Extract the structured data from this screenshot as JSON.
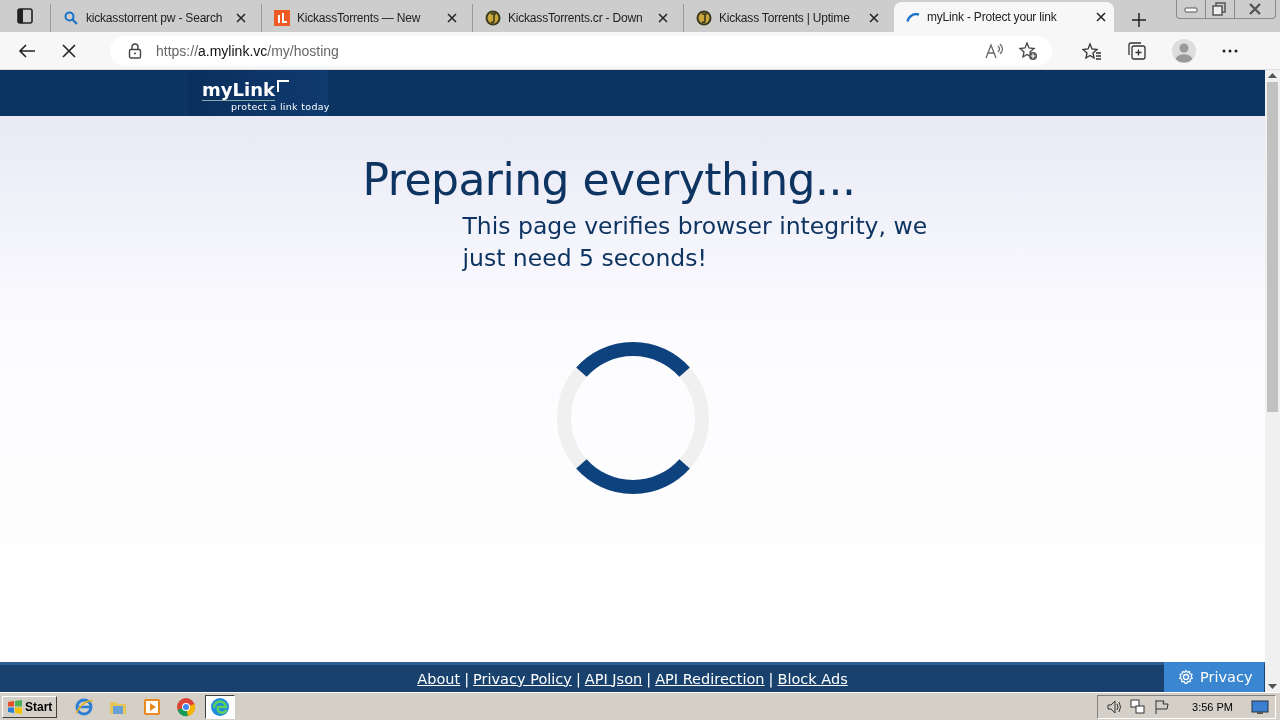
{
  "browser": {
    "tabs": [
      {
        "title": "kickasstorrent pw - Search",
        "kind": "search",
        "selected": false
      },
      {
        "title": "KickassTorrents — New",
        "kind": "orange",
        "selected": false
      },
      {
        "title": "KickassTorrents.cr - Down",
        "kind": "gold",
        "selected": false
      },
      {
        "title": "Kickass Torrents | Uptime",
        "kind": "gold",
        "selected": false
      },
      {
        "title": "myLink - Protect your link",
        "kind": "loading",
        "selected": true
      }
    ],
    "address": {
      "scheme": "https://",
      "host": "a.mylink.vc",
      "path": "/my/hosting"
    },
    "loading": true
  },
  "page": {
    "logo": {
      "name": "myLink",
      "tagline": "protect a link today"
    },
    "heading": "Preparing everything...",
    "message": "This page verifies browser integrity, we just need 5 seconds!",
    "footer_links": [
      "About",
      "Privacy Policy",
      "API Json",
      "API Redirection",
      "Block Ads"
    ],
    "separator": "|",
    "privacy_button": "Privacy"
  },
  "taskbar": {
    "start": "Start",
    "apps": [
      {
        "kind": "ie",
        "selected": false
      },
      {
        "kind": "folder",
        "selected": false
      },
      {
        "kind": "media",
        "selected": false
      },
      {
        "kind": "chrome",
        "selected": false
      },
      {
        "kind": "edge",
        "selected": true
      }
    ],
    "clock": "3:56 PM"
  }
}
